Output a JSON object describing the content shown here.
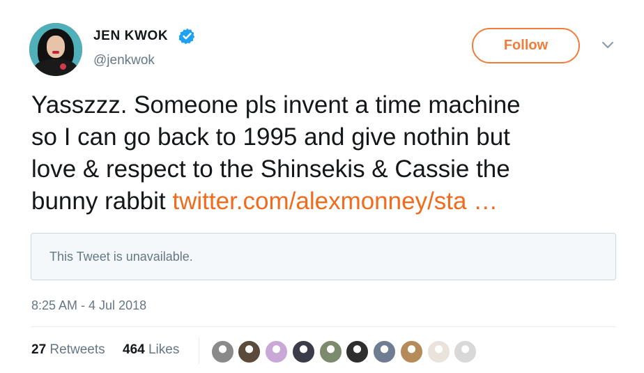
{
  "author": {
    "name": "JEN KWOK",
    "handle": "@jenkwok",
    "verified": true,
    "avatar_icon": "profile-photo"
  },
  "actions": {
    "follow_label": "Follow",
    "more_icon": "chevron-down-icon"
  },
  "tweet": {
    "text": "Yasszzz. Someone pls invent a time machine\nso I can go back to 1995 and give nothin but\nlove & respect to the Shinsekis & Cassie the\nbunny rabbit ",
    "link_text": "twitter.com/alexmonney/sta …",
    "quoted_status": "This Tweet is unavailable.",
    "timestamp": "8:25 AM - 4 Jul 2018"
  },
  "stats": {
    "retweets_count": "27",
    "retweets_label": "Retweets",
    "likes_count": "464",
    "likes_label": "Likes"
  },
  "colors": {
    "accent": "#f27c3a",
    "link": "#f26a1c",
    "verified": "#1da1f2",
    "muted_text": "#657786",
    "border": "#ccd6dd"
  },
  "likers": [
    {
      "color": "#8a8a8a"
    },
    {
      "color": "#5b4a3c"
    },
    {
      "color": "#c9a8d8"
    },
    {
      "color": "#3b3b4a"
    },
    {
      "color": "#7c8a6e"
    },
    {
      "color": "#2f2f2f"
    },
    {
      "color": "#6f7d93"
    },
    {
      "color": "#b68b5a"
    },
    {
      "color": "#e9e3dc"
    }
  ]
}
